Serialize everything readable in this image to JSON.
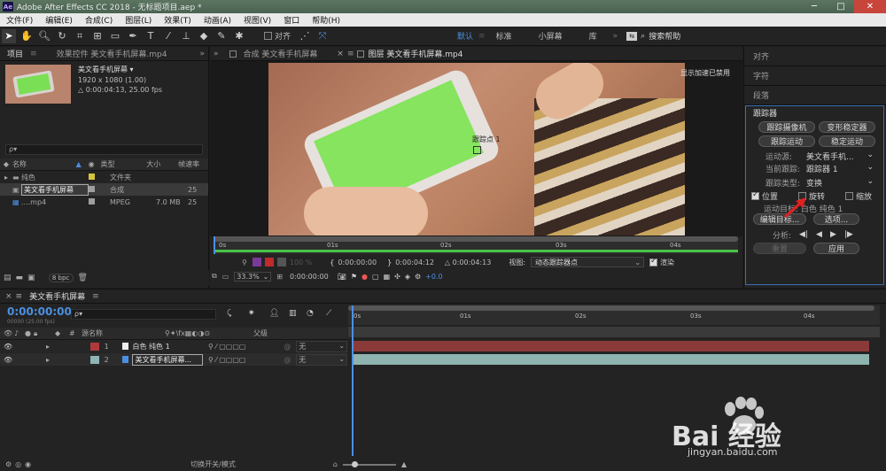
{
  "app": {
    "title": "Adobe After Effects CC 2018 - 无标题项目.aep *",
    "logo": "Ae",
    "window_controls": {
      "minimize": "─",
      "maximize": "□",
      "close": "✕"
    }
  },
  "menu": [
    "文件(F)",
    "编辑(E)",
    "合成(C)",
    "图层(L)",
    "效果(T)",
    "动画(A)",
    "视图(V)",
    "窗口",
    "帮助(H)"
  ],
  "toolbar": {
    "snap_label": "对齐",
    "workspaces": [
      "默认",
      "标准",
      "小屏幕",
      "库"
    ],
    "search_placeholder": "搜索帮助"
  },
  "project": {
    "tabs": [
      "项目",
      "效果控件 美文看手机屏幕.mp4"
    ],
    "selected_name": "美文看手机屏幕 ▾",
    "selected_info1": "1920 x 1080 (1.00)",
    "selected_info2": "△ 0:00:04:13, 25.00 fps",
    "search_placeholder": "ρ▾",
    "columns": [
      "名称",
      "类型",
      "大小",
      "帧速率"
    ],
    "items": [
      {
        "name": "纯色",
        "type": "文件夹",
        "size": "",
        "fps": "",
        "color": "#d6c53c",
        "icon": "folder-icon"
      },
      {
        "name": "美文看手机屏幕",
        "type": "合成",
        "size": "",
        "fps": "25",
        "color": "#9e9e9e",
        "icon": "composition-icon"
      },
      {
        "name": "....mp4",
        "type": "MPEG",
        "size": "7.0 MB",
        "fps": "25",
        "color": "#9e9e9e",
        "icon": "video-file-icon"
      }
    ],
    "bpc": "8 bpc"
  },
  "viewer": {
    "tabs": [
      "合成 美文看手机屏幕",
      "图层 美文看手机屏幕.mp4"
    ],
    "gpu_note": "显示加速已禁用",
    "track_point": "跟踪点 1",
    "ruler": [
      "0s",
      "01s",
      "02s",
      "03s",
      "04s"
    ],
    "time_start": "0:00:00:00",
    "time_end": "0:00:04:12",
    "duration": "△ 0:00:04:13",
    "zoom_pct": "100 %",
    "view_label": "视图:",
    "view_value": "动态跟踪器点",
    "render_label": "渲染",
    "zoom": "33.3%",
    "current_time": "0:00:00:00",
    "offset": "+0.0"
  },
  "right_panels": [
    "对齐",
    "字符",
    "段落"
  ],
  "tracker": {
    "title": "跟踪器",
    "buttons": [
      "跟踪摄像机",
      "变形稳定器",
      "跟踪运动",
      "稳定运动"
    ],
    "source_label": "运动源:",
    "source_value": "美文看手机...",
    "current_label": "当前跟踪:",
    "current_value": "跟踪器 1",
    "type_label": "跟踪类型:",
    "type_value": "变换",
    "position": "位置",
    "rotation": "旋转",
    "scale": "缩放",
    "target": "运动目标: 白色 纯色 1",
    "edit_target": "编辑目标...",
    "options": "选项...",
    "analyze_label": "分析:",
    "reset": "重置",
    "apply": "应用"
  },
  "timeline": {
    "tab": "美文看手机屏幕",
    "timecode": "0:00:00:00",
    "frames": "00000 (25.00 fps)",
    "search_placeholder": "ρ▾",
    "columns": {
      "num": "#",
      "name": "源名称",
      "parent": "父级"
    },
    "layers": [
      {
        "num": "1",
        "name": "白色 纯色 1",
        "color": "#b03a3a",
        "parent": "无",
        "bar": "#8b3a3a"
      },
      {
        "num": "2",
        "name": "美文看手机屏幕...",
        "color": "#8fb5b5",
        "parent": "无",
        "bar": "#8fb3ae"
      }
    ],
    "ruler": [
      "0s",
      "01s",
      "02s",
      "03s",
      "04s"
    ],
    "footer": "切换开关/模式"
  },
  "watermark": {
    "brand": "Bai  经验",
    "url": "jingyan.baidu.com"
  },
  "colors": {
    "accent": "#4a90e2",
    "green": "#86e45f",
    "title_bg": "#506a56"
  }
}
